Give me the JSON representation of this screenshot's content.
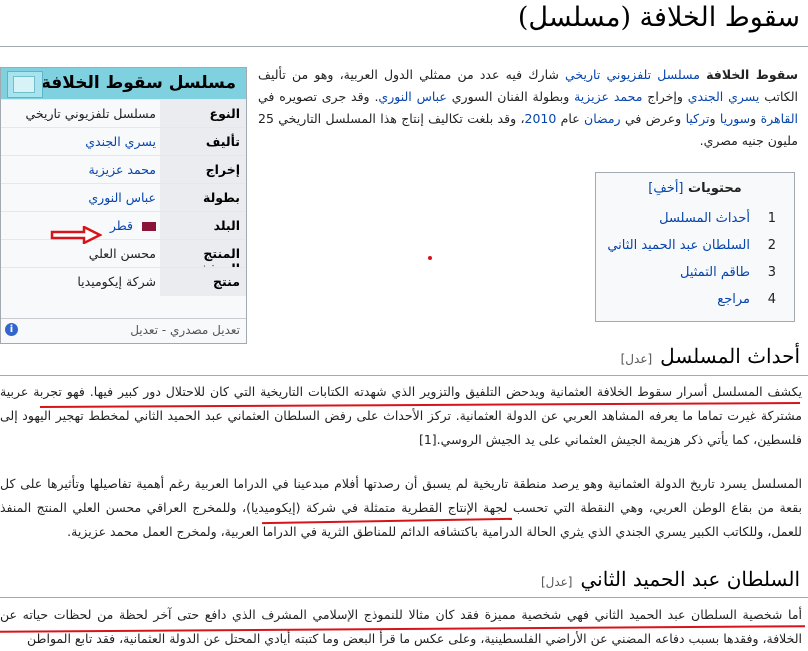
{
  "page": {
    "title": "سقوط الخلافة (مسلسل)"
  },
  "infobox": {
    "header": "مسلسل سقوط الخلافة",
    "rows": [
      {
        "key": "النوع",
        "value": "مسلسل تلفزيوني تاريخي"
      },
      {
        "key": "تأليف",
        "value": "يسري الجندي"
      },
      {
        "key": "إخراج",
        "value": "محمد عزيزية"
      },
      {
        "key": "بطولة",
        "value": "عباس النوري"
      },
      {
        "key": "البلد",
        "value": "قطر"
      },
      {
        "key": "المنتج المنفذ",
        "value": "محسن العلي"
      },
      {
        "key": "منتج",
        "value": "شركة إيكوميديا"
      }
    ],
    "footer": "تعديل مصدري - تعديل"
  },
  "lead": {
    "t1": "سقوط الخلافة",
    "t2": " ",
    "t3": "مسلسل تلفزيوني تاريخي",
    "t4": " شارك فيه عدد من ممثلي الدول العربية، وهو من تأليف الكاتب ",
    "t5": "يسري الجندي",
    "t6": " وإخراج ",
    "t7": "محمد عزيزية",
    "t8": " وبطولة الفنان السوري ",
    "t9": "عباس النوري",
    "t10": ". وقد جرى تصويره في ",
    "t11": "القاهرة",
    "t12": " و",
    "t13": "سوريا",
    "t14": " و",
    "t15": "تركيا",
    "t16": " وعرض في ",
    "t17": "رمضان",
    "t18": " عام ",
    "t19": "2010",
    "t20": "، وقد بلغت تكاليف إنتاج هذا المسلسل التاريخي 25 مليون جنيه مصري."
  },
  "toc": {
    "title": "محتويات",
    "toggle": "[أخفِ]",
    "items": [
      {
        "num": "1",
        "label": "أحداث المسلسل"
      },
      {
        "num": "2",
        "label": "السلطان عبد الحميد الثاني"
      },
      {
        "num": "3",
        "label": "طاقم التمثيل"
      },
      {
        "num": "4",
        "label": "مراجع"
      }
    ]
  },
  "section1": {
    "heading": "أحداث المسلسل",
    "edit": "[عدل]",
    "p1": "يكشف المسلسل أسرار سقوط الخلافة العثمانية ويدحض التلفيق والتزوير الذي شهدته الكتابات التاريخية التي كان للاحتلال دور كبير فيها. فهو تجربة عربية مشتركة غيرت تماما ما يعرفه المشاهد العربي عن الدولة العثمانية. تركز الأحداث على رفض السلطان العثماني عبد الحميد الثاني لمخطط تهجير اليهود إلى فلسطين، كما يأتي ذكر هزيمة الجيش العثماني على يد الجيش الروسي.[1]",
    "p2": "المسلسل يسرد تاريخ الدولة العثمانية وهو يرصد منطقة تاريخية لم يسبق أن رصدتها أفلام مبدعينا في الدراما العربية رغم أهمية تفاصيلها وتأثيرها على كل بقعة من بقاع الوطن العربي، وهي النقطة التي تحسب لجهة الإنتاج القطرية متمثلة في شركة (إيكوميديا)، وللمخرج العراقي محسن العلي المنتج المنفذ للعمل، وللكاتب الكبير يسري الجندي الذي يثري الحالة الدرامية باكتشافه الدائم للمناطق الثرية في الدراما العربية، ولمخرج العمل محمد عزيزية."
  },
  "section2": {
    "heading": "السلطان عبد الحميد الثاني",
    "edit": "[عدل]",
    "p1": "أما شخصية السلطان عبد الحميد الثاني فهي شخصية مميزة فقد كان مثالا للنموذج الإسلامي المشرف الذي دافع حتى آخر لحظة من لحظات حياته عن الخلافة، وفقدها بسبب دفاعه المضني عن الأراضي الفلسطينية، وعلى عكس ما قرأ البعض وما كتبته أيادي المحتل عن الدولة العثمانية، فقد تابع المواطن"
  }
}
